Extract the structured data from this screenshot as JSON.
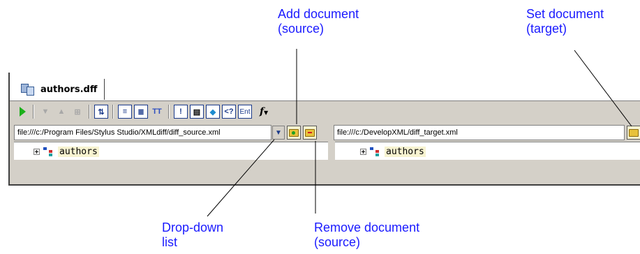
{
  "callouts": {
    "add_source": [
      "Add document",
      "(source)"
    ],
    "set_target": [
      "Set document",
      "(target)"
    ],
    "dropdown": [
      "Drop-down",
      "list"
    ],
    "remove_source": [
      "Remove document",
      "(source)"
    ]
  },
  "colors": {
    "callout": "#1a1aff",
    "play": "#1bb01b",
    "node_bg": "#f7f3d0"
  },
  "tab": {
    "label": "authors.dff",
    "icon": "diff-file-icon"
  },
  "toolbar": {
    "items": [
      {
        "name": "run-icon",
        "text": ""
      },
      {
        "name": "next-diff-icon",
        "text": "▼"
      },
      {
        "name": "prev-diff-icon",
        "text": "▲"
      },
      {
        "name": "grid-icon",
        "text": "⊞"
      },
      {
        "name": "split-view-icon",
        "text": "⇅"
      },
      {
        "name": "tree-view-icon",
        "text": "≡"
      },
      {
        "name": "merged-tree-icon",
        "text": "≣"
      },
      {
        "name": "text-view-icon",
        "text": "TT"
      },
      {
        "name": "exclaim-icon",
        "text": "!"
      },
      {
        "name": "document-icon",
        "text": "▤"
      },
      {
        "name": "tag-icon",
        "text": "◆"
      },
      {
        "name": "processing-instruction-icon",
        "text": "<?"
      },
      {
        "name": "entity-icon",
        "text": "Ent"
      },
      {
        "name": "function-icon",
        "text": "f"
      }
    ]
  },
  "source": {
    "path": "file:///c:/Program Files/Stylus Studio/XMLdiff/diff_source.xml",
    "dropdown_glyph": "▼",
    "root": "authors"
  },
  "target": {
    "path": "file:///c:/DevelopXML/diff_target.xml",
    "root": "authors"
  }
}
